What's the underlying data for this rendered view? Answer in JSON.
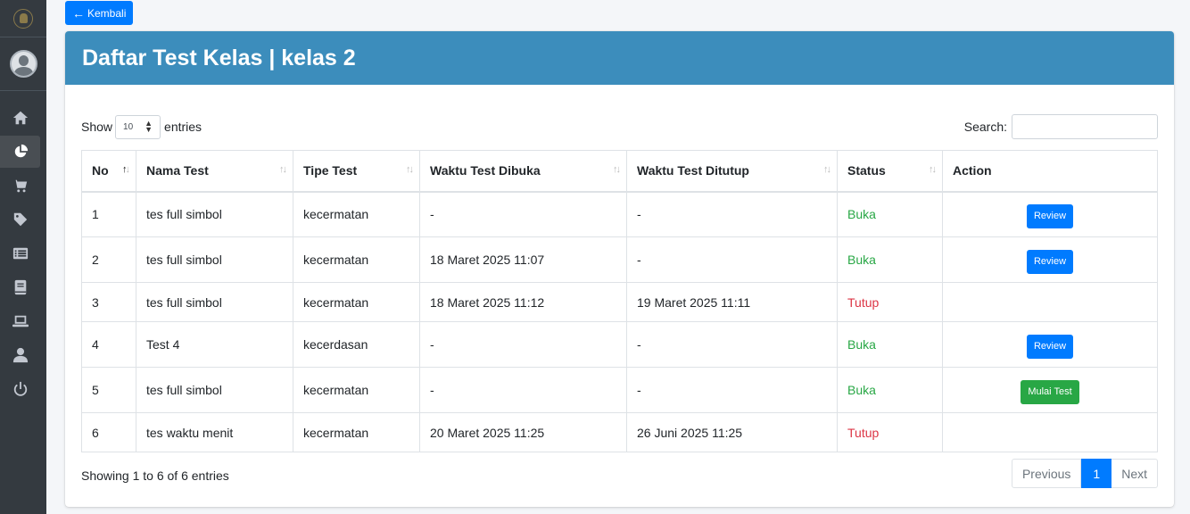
{
  "back_label": "Kembali",
  "page_title": "Daftar Test Kelas | kelas 2",
  "controls": {
    "show_label": "Show",
    "entries_value": "10",
    "entries_label": "entries",
    "search_label": "Search:"
  },
  "table": {
    "headers": [
      "No",
      "Nama Test",
      "Tipe Test",
      "Waktu Test Dibuka",
      "Waktu Test Ditutup",
      "Status",
      "Action"
    ],
    "rows": [
      {
        "no": "1",
        "nama": "tes full simbol",
        "tipe": "kecermatan",
        "dibuka": "-",
        "ditutup": "-",
        "status": "Buka",
        "action": "Review"
      },
      {
        "no": "2",
        "nama": "tes full simbol",
        "tipe": "kecermatan",
        "dibuka": "18 Maret 2025 11:07",
        "ditutup": "-",
        "status": "Buka",
        "action": "Review"
      },
      {
        "no": "3",
        "nama": "tes full simbol",
        "tipe": "kecermatan",
        "dibuka": "18 Maret 2025 11:12",
        "ditutup": "19 Maret 2025 11:11",
        "status": "Tutup",
        "action": ""
      },
      {
        "no": "4",
        "nama": "Test 4",
        "tipe": "kecerdasan",
        "dibuka": "-",
        "ditutup": "-",
        "status": "Buka",
        "action": "Review"
      },
      {
        "no": "5",
        "nama": "tes full simbol",
        "tipe": "kecermatan",
        "dibuka": "-",
        "ditutup": "-",
        "status": "Buka",
        "action": "Mulai Test"
      },
      {
        "no": "6",
        "nama": "tes waktu menit",
        "tipe": "kecermatan",
        "dibuka": "20 Maret 2025 11:25",
        "ditutup": "26 Juni 2025 11:25",
        "status": "Tutup",
        "action": ""
      }
    ]
  },
  "footer": {
    "info": "Showing 1 to 6 of 6 entries",
    "previous": "Previous",
    "current_page": "1",
    "next": "Next"
  },
  "sidebar_icons": [
    "home-icon",
    "chart-pie-icon",
    "shopping-cart-icon",
    "tag-icon",
    "list-icon",
    "book-icon",
    "laptop-icon",
    "user-icon",
    "power-icon"
  ],
  "colors": {
    "header": "#3c8dbc",
    "primary": "#007bff",
    "success": "#28a745",
    "danger": "#dc3545",
    "sidebar": "#343a40"
  }
}
